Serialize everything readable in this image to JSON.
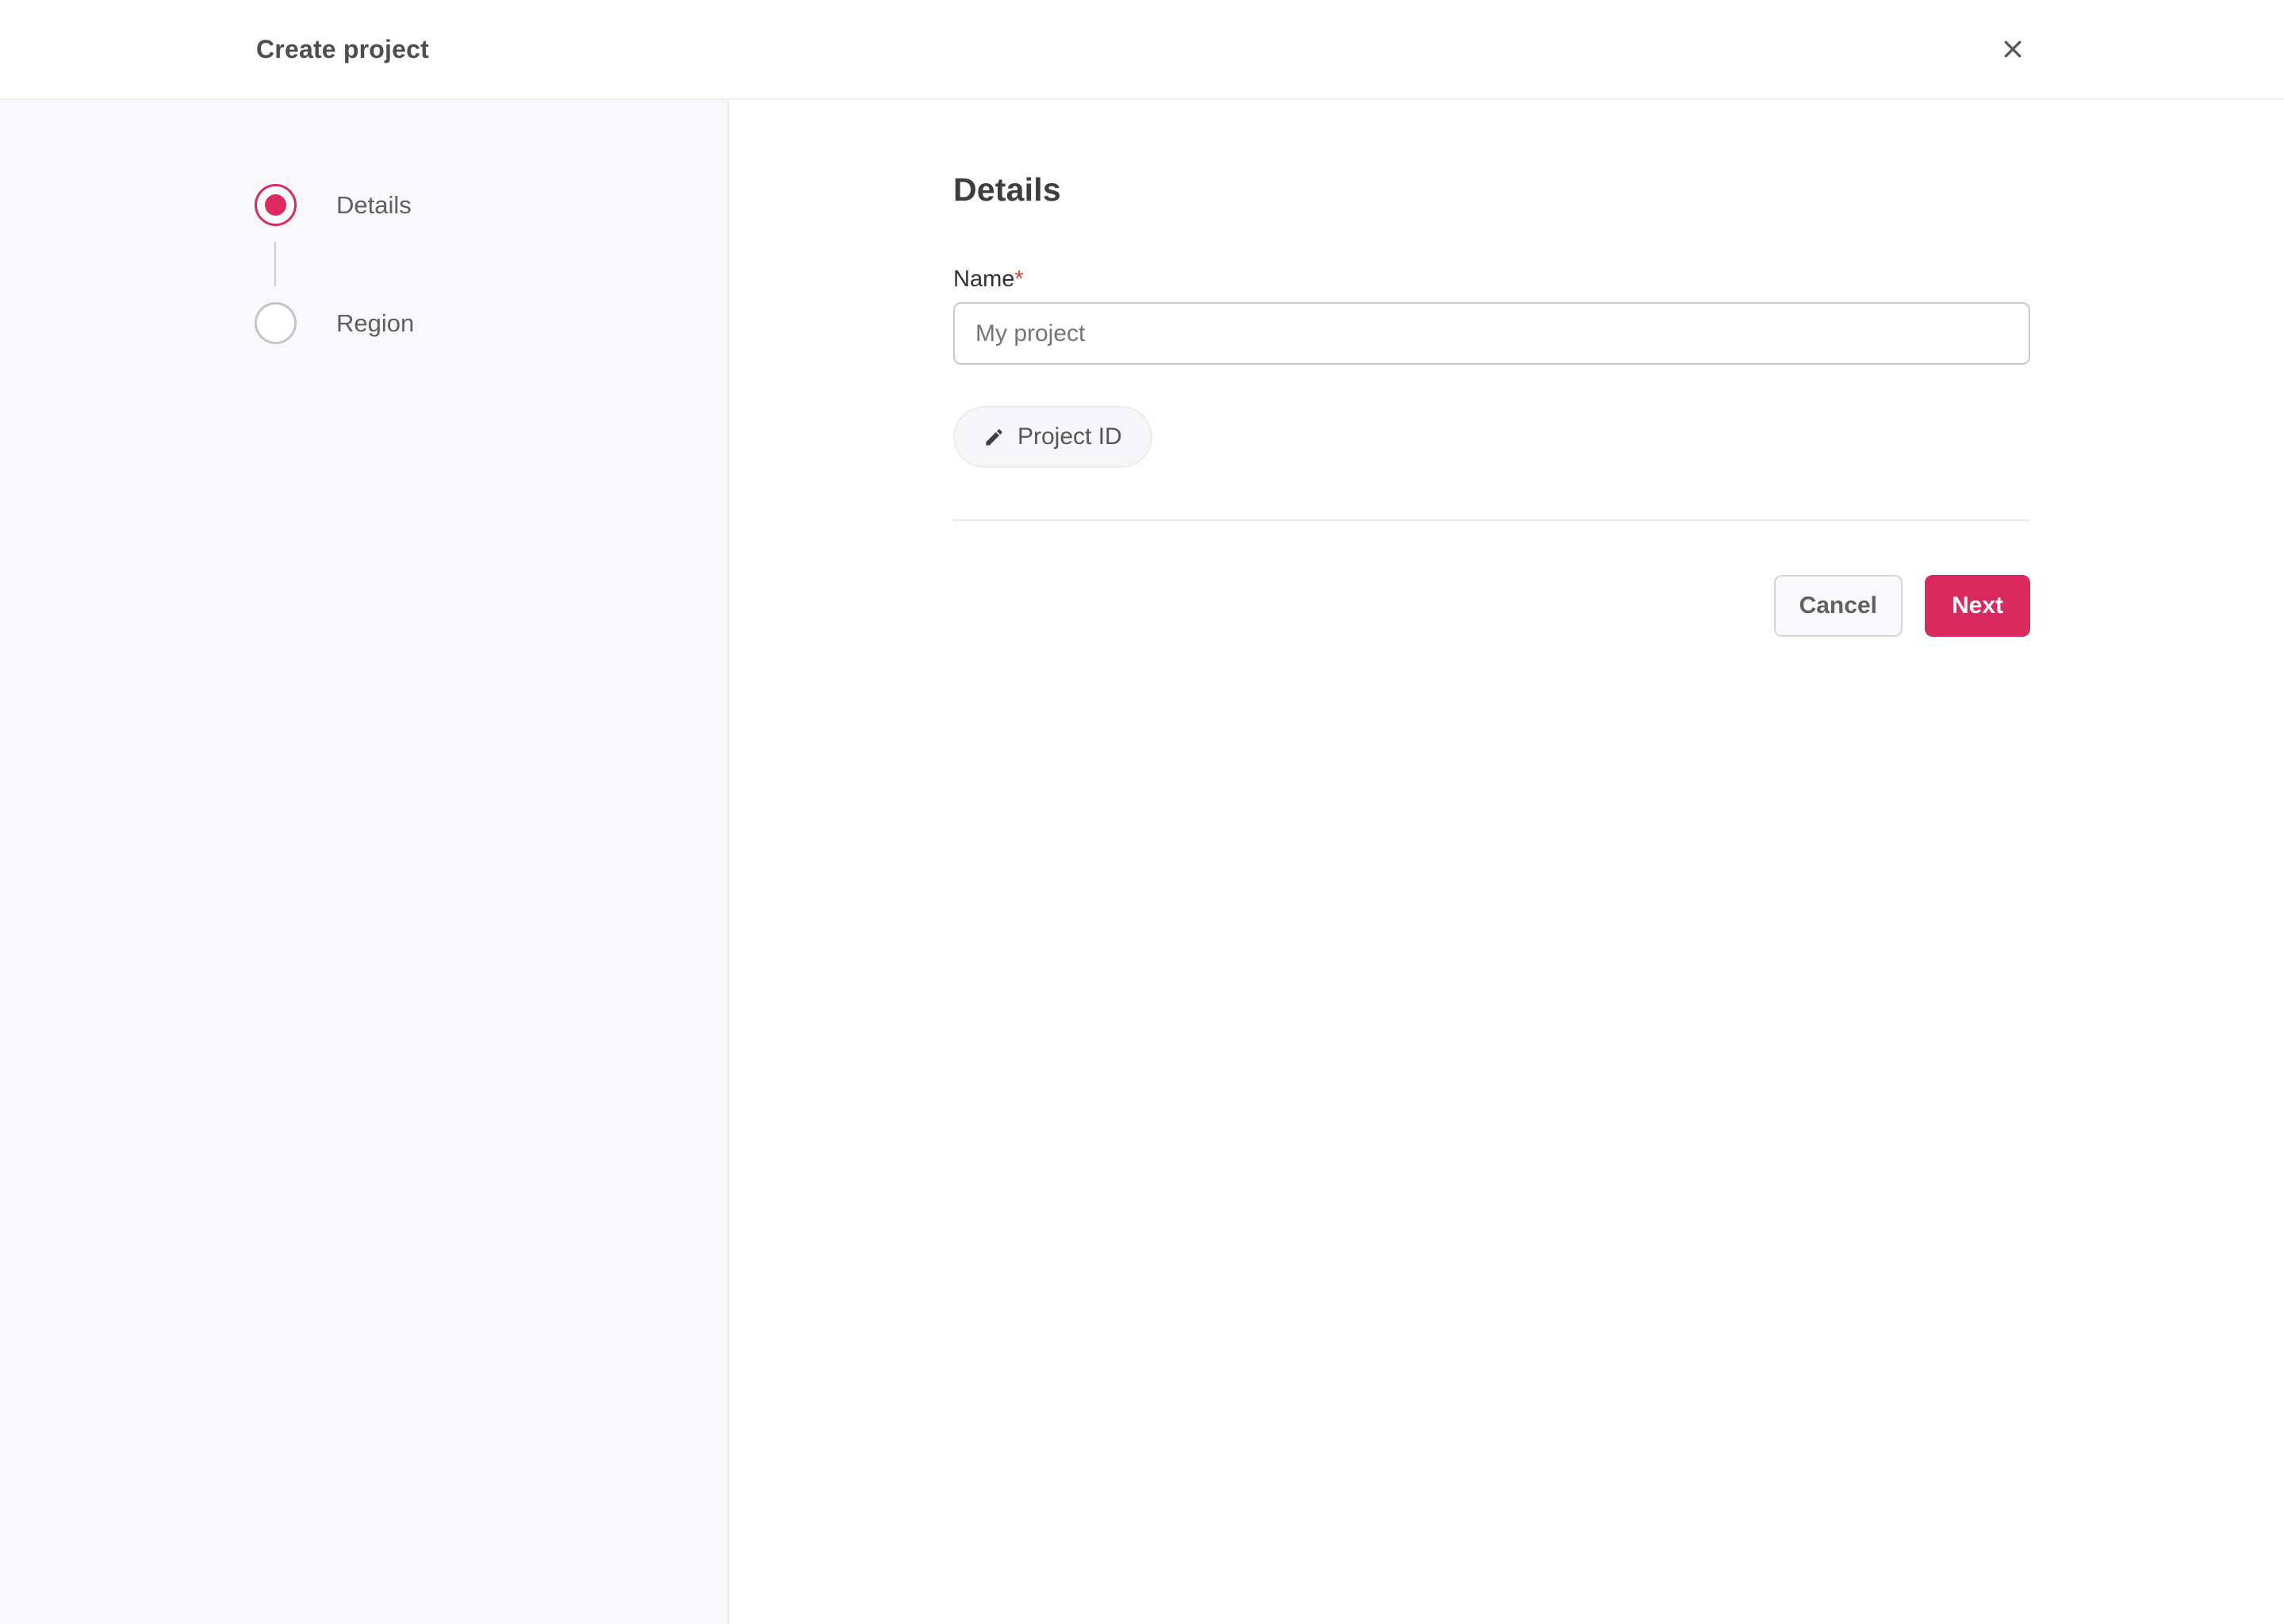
{
  "modal": {
    "title": "Create project",
    "close_icon": "x-icon"
  },
  "stepper": {
    "steps": [
      {
        "label": "Details",
        "state": "active"
      },
      {
        "label": "Region",
        "state": "upcoming"
      }
    ]
  },
  "main": {
    "heading": "Details",
    "name_field": {
      "label": "Name",
      "required_marker": "*",
      "value": "My project"
    },
    "project_id_button": {
      "label": "Project ID",
      "icon": "pencil-icon"
    }
  },
  "footer": {
    "cancel_label": "Cancel",
    "next_label": "Next"
  },
  "colors": {
    "accent": "#d9295e",
    "required_marker": "#ee392b",
    "sidebar_bg": "#f8f8fa",
    "header_border": "#efeff2",
    "input_border": "#c9c9cd",
    "muted_text": "#5e5e65"
  }
}
